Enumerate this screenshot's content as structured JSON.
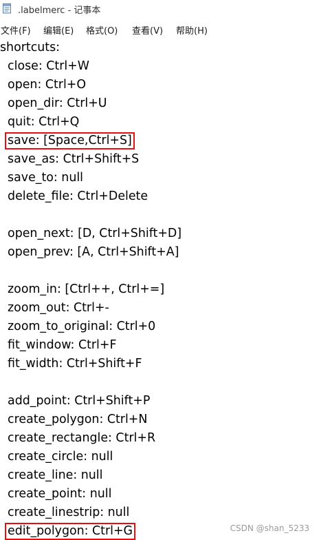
{
  "window": {
    "title": ".labelmerc - 记事本",
    "icon": "notepad-icon"
  },
  "menu": {
    "file": "文件(F)",
    "edit": "编辑(E)",
    "format": "格式(O)",
    "view": "查看(V)",
    "help": "帮助(H)"
  },
  "editor": {
    "lines": [
      "shortcuts:",
      "  close: Ctrl+W",
      "  open: Ctrl+O",
      "  open_dir: Ctrl+U",
      "  quit: Ctrl+Q",
      "  save: [Space,Ctrl+S]",
      "  save_as: Ctrl+Shift+S",
      "  save_to: null",
      "  delete_file: Ctrl+Delete",
      "",
      "  open_next: [D, Ctrl+Shift+D]",
      "  open_prev: [A, Ctrl+Shift+A]",
      "",
      "  zoom_in: [Ctrl++, Ctrl+=]",
      "  zoom_out: Ctrl+-",
      "  zoom_to_original: Ctrl+0",
      "  fit_window: Ctrl+F",
      "  fit_width: Ctrl+Shift+F",
      "",
      "  add_point: Ctrl+Shift+P",
      "  create_polygon: Ctrl+N",
      "  create_rectangle: Ctrl+R",
      "  create_circle: null",
      "  create_line: null",
      "  create_point: null",
      "  create_linestrip: null",
      "  edit_polygon: Ctrl+G"
    ],
    "highlighted_lines": [
      5,
      26
    ]
  },
  "watermark": "CSDN @shan_5233",
  "colors": {
    "highlight_border": "#e21010",
    "text": "#000000",
    "background": "#ffffff"
  }
}
